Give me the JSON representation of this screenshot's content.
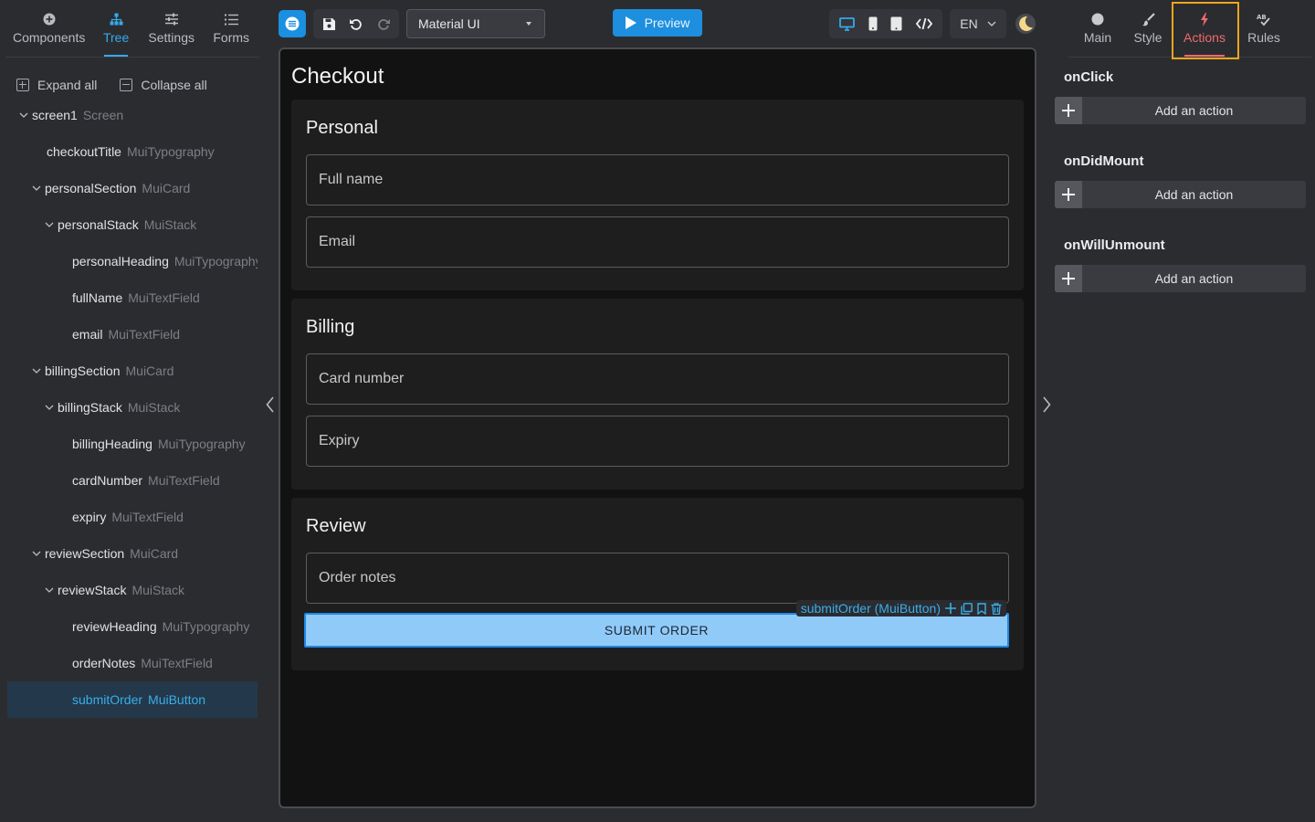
{
  "left_tabs": [
    {
      "label": "Components",
      "icon": "plus-circle-icon"
    },
    {
      "label": "Tree",
      "icon": "tree-icon"
    },
    {
      "label": "Settings",
      "icon": "sliders-icon"
    },
    {
      "label": "Forms",
      "icon": "list-icon"
    }
  ],
  "active_left_tab": "Tree",
  "expand_all": "Expand all",
  "collapse_all": "Collapse all",
  "tree": [
    {
      "name": "screen1",
      "type": "Screen",
      "expanded": true
    },
    {
      "name": "checkoutTitle",
      "type": "MuiTypography"
    },
    {
      "name": "personalSection",
      "type": "MuiCard",
      "expanded": true
    },
    {
      "name": "personalStack",
      "type": "MuiStack",
      "expanded": true
    },
    {
      "name": "personalHeading",
      "type": "MuiTypography"
    },
    {
      "name": "fullName",
      "type": "MuiTextField"
    },
    {
      "name": "email",
      "type": "MuiTextField"
    },
    {
      "name": "billingSection",
      "type": "MuiCard",
      "expanded": true
    },
    {
      "name": "billingStack",
      "type": "MuiStack",
      "expanded": true
    },
    {
      "name": "billingHeading",
      "type": "MuiTypography"
    },
    {
      "name": "cardNumber",
      "type": "MuiTextField"
    },
    {
      "name": "expiry",
      "type": "MuiTextField"
    },
    {
      "name": "reviewSection",
      "type": "MuiCard",
      "expanded": true
    },
    {
      "name": "reviewStack",
      "type": "MuiStack",
      "expanded": true
    },
    {
      "name": "reviewHeading",
      "type": "MuiTypography"
    },
    {
      "name": "orderNotes",
      "type": "MuiTextField"
    },
    {
      "name": "submitOrder",
      "type": "MuiButton",
      "selected": true
    }
  ],
  "toolbar": {
    "framework": "Material UI",
    "preview": "Preview",
    "language": "EN"
  },
  "canvas": {
    "title": "Checkout",
    "personal": {
      "heading": "Personal",
      "fields": [
        "Full name",
        "Email"
      ]
    },
    "billing": {
      "heading": "Billing",
      "fields": [
        "Card number",
        "Expiry"
      ]
    },
    "review": {
      "heading": "Review",
      "fields": [
        "Order notes"
      ]
    },
    "submit_label": "SUBMIT ORDER",
    "selection_label": "submitOrder (MuiButton)"
  },
  "right_tabs": [
    {
      "label": "Main",
      "icon": "circle-icon"
    },
    {
      "label": "Style",
      "icon": "brush-icon"
    },
    {
      "label": "Actions",
      "icon": "lightning-icon"
    },
    {
      "label": "Rules",
      "icon": "rules-icon"
    }
  ],
  "active_right_tab": "Actions",
  "events": [
    {
      "name": "onClick",
      "add_label": "Add an action"
    },
    {
      "name": "onDidMount",
      "add_label": "Add an action"
    },
    {
      "name": "onWillUnmount",
      "add_label": "Add an action"
    }
  ],
  "colors": {
    "accent_blue": "#36a9ea",
    "actions_red": "#ee6a6a",
    "highlight_orange": "#f2a51d",
    "button_fill": "#90caf9"
  }
}
